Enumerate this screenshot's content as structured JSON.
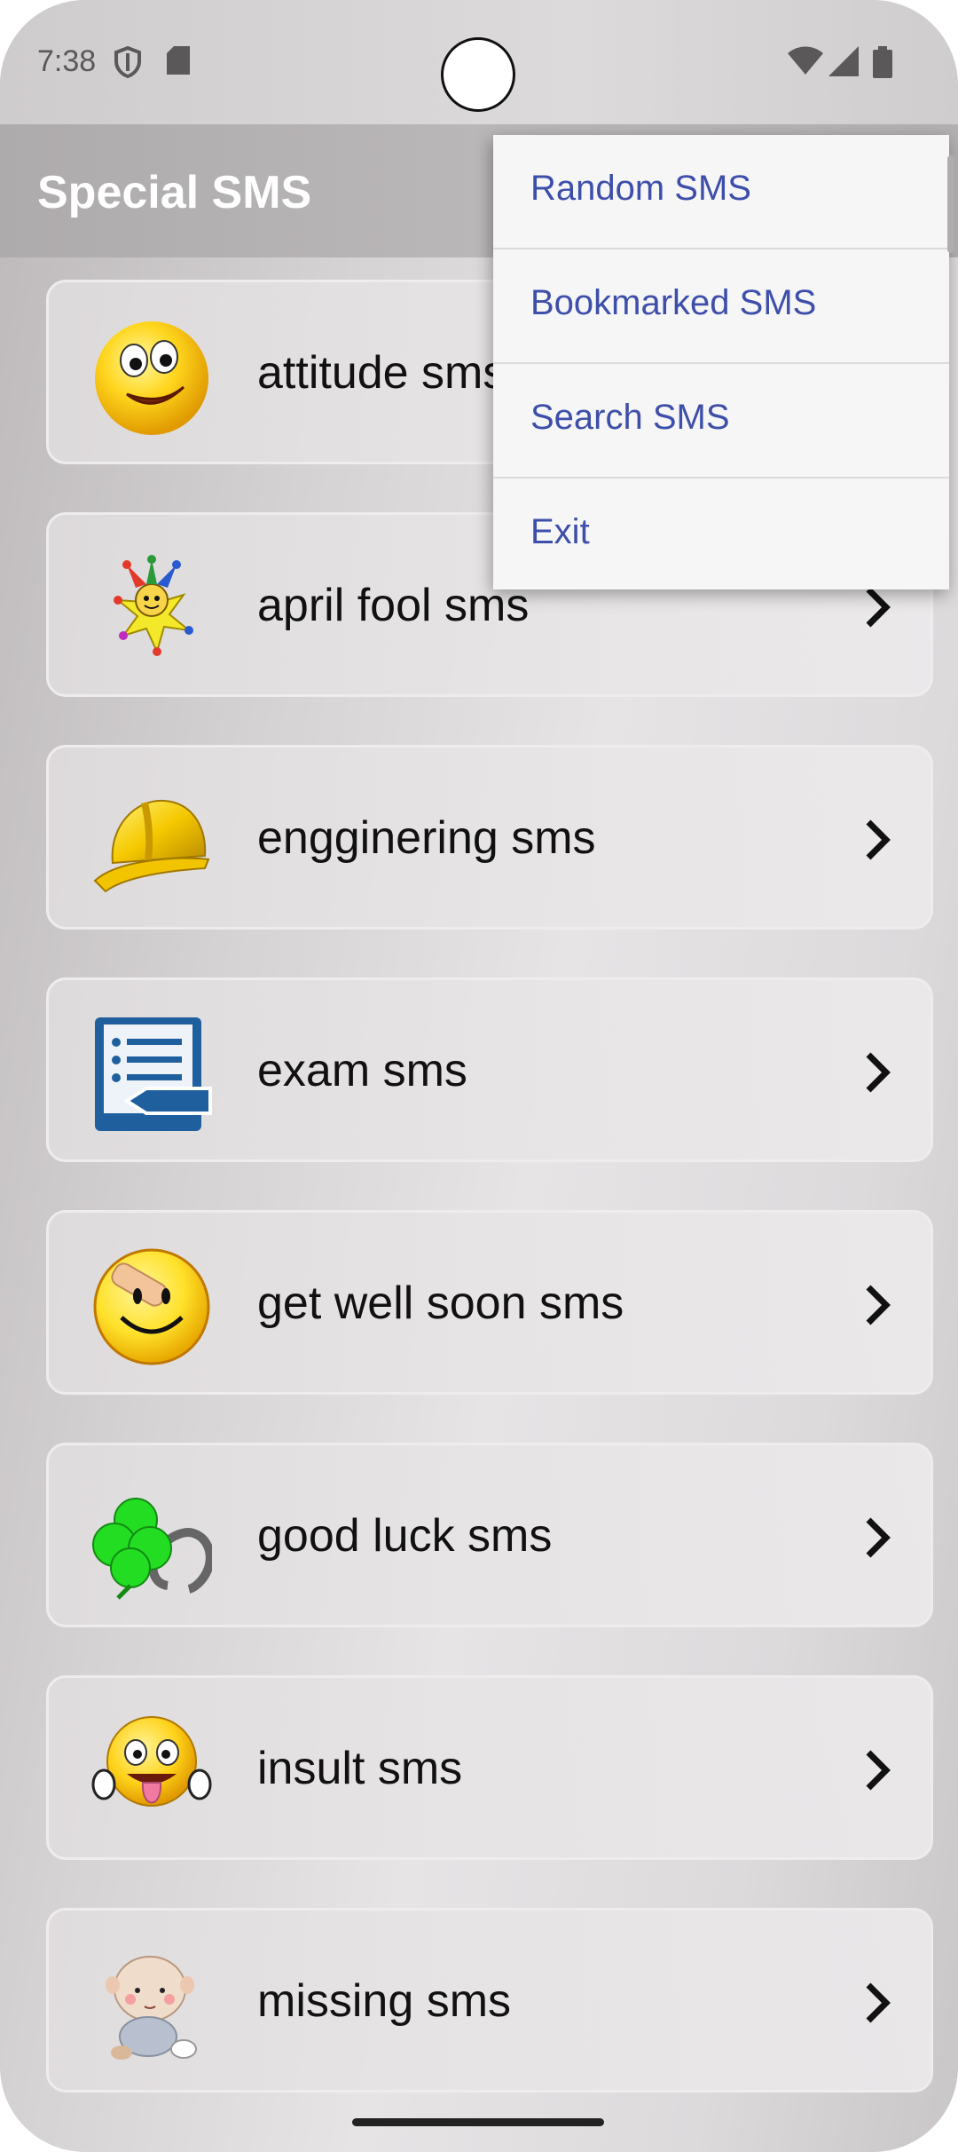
{
  "status_bar": {
    "time": "7:38"
  },
  "app": {
    "title": "Special SMS"
  },
  "menu": {
    "items": [
      {
        "label": "Random SMS"
      },
      {
        "label": "Bookmarked SMS"
      },
      {
        "label": "Search SMS"
      },
      {
        "label": "Exit"
      }
    ]
  },
  "list": {
    "items": [
      {
        "label": "attitude sms",
        "icon": "winking-smiley-icon"
      },
      {
        "label": "april fool sms",
        "icon": "jester-icon"
      },
      {
        "label": "engginering sms",
        "icon": "hard-hat-icon"
      },
      {
        "label": "exam sms",
        "icon": "exam-paper-icon"
      },
      {
        "label": "get well soon sms",
        "icon": "bandaged-smiley-icon"
      },
      {
        "label": "good luck sms",
        "icon": "four-leaf-clover-icon"
      },
      {
        "label": "insult sms",
        "icon": "tongue-out-smiley-icon"
      },
      {
        "label": "missing sms",
        "icon": "baby-icon"
      }
    ]
  },
  "colors": {
    "menu_text": "#3d4faa",
    "app_bar": "#b4b1b2"
  }
}
